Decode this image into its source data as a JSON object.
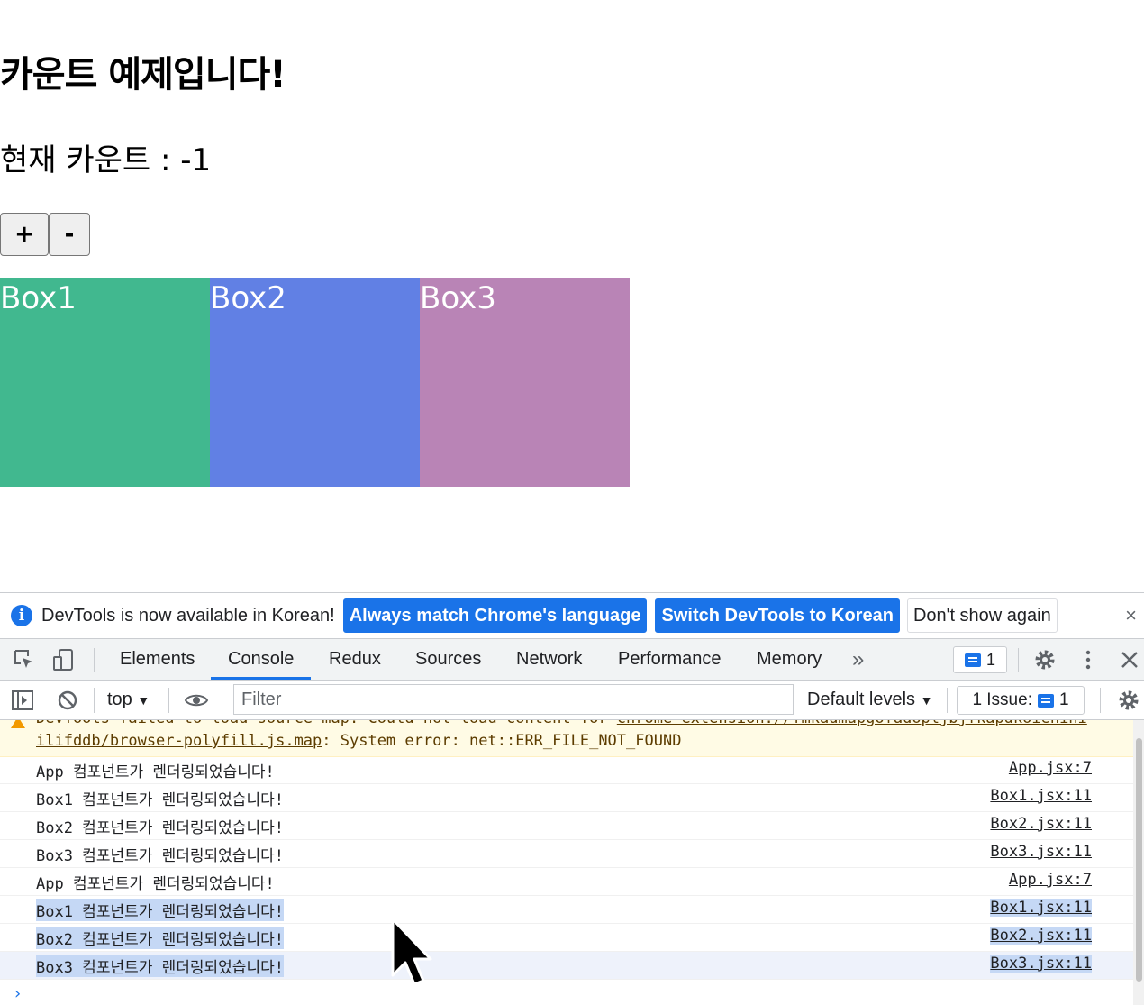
{
  "app": {
    "title": "카운트 예제입니다!",
    "count_text": "현재 카운트 : -1",
    "plus_label": "+",
    "minus_label": "-",
    "boxes": [
      {
        "label": "Box1",
        "color": "#41b88f"
      },
      {
        "label": "Box2",
        "color": "#6180e4"
      },
      {
        "label": "Box3",
        "color": "#b984b6"
      }
    ]
  },
  "infobar": {
    "message": "DevTools is now available in Korean!",
    "match_label": "Always match Chrome's language",
    "switch_label": "Switch DevTools to Korean",
    "dismiss_label": "Don't show again",
    "close_label": "×"
  },
  "devtools": {
    "tabs": [
      "Elements",
      "Console",
      "Redux",
      "Sources",
      "Network",
      "Performance",
      "Memory"
    ],
    "active_tab": "Console",
    "more_tabs": "»",
    "message_count": "1",
    "toolbar": {
      "context": "top",
      "filter_placeholder": "Filter",
      "levels": "Default levels",
      "issues_label": "1 Issue:",
      "issues_count": "1"
    },
    "warning": {
      "line1": "DevTools failed to load source map: Could not load content for ",
      "line1_link": "chrome-extension://fmkadmapgofadopljbjfkapdkoienihi",
      "line2_link": "ilifddb/browser-polyfill.js.map",
      "line2_rest": ": System error: net::ERR_FILE_NOT_FOUND"
    },
    "logs": [
      {
        "msg": "App 컴포넌트가 렌더링되었습니다!",
        "src": "App.jsx:7"
      },
      {
        "msg": "Box1 컴포넌트가 렌더링되었습니다!",
        "src": "Box1.jsx:11"
      },
      {
        "msg": "Box2 컴포넌트가 렌더링되었습니다!",
        "src": "Box2.jsx:11"
      },
      {
        "msg": "Box3 컴포넌트가 렌더링되었습니다!",
        "src": "Box3.jsx:11"
      },
      {
        "msg": "App 컴포넌트가 렌더링되었습니다!",
        "src": "App.jsx:7"
      },
      {
        "msg": "Box1 컴포넌트가 렌더링되었습니다!",
        "src": "Box1.jsx:11"
      },
      {
        "msg": "Box2 컴포넌트가 렌더링되었습니다!",
        "src": "Box2.jsx:11"
      },
      {
        "msg": "Box3 컴포넌트가 렌더링되었습니다!",
        "src": "Box3.jsx:11"
      }
    ],
    "prompt": "›"
  }
}
